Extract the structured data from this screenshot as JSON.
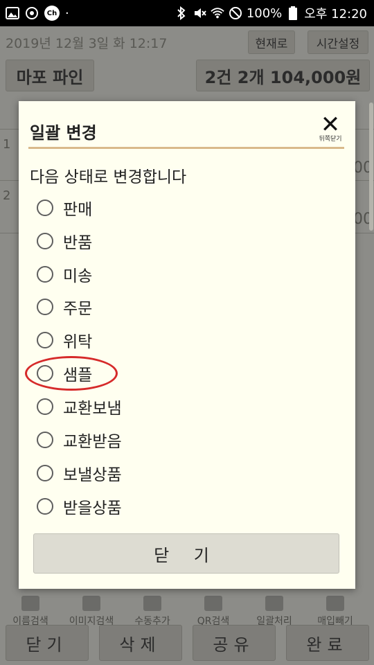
{
  "status_bar": {
    "battery": "100%",
    "time": "오후 12:20",
    "left_icons": [
      "image-icon",
      "target-icon",
      "ch-app-icon",
      "dot-icon"
    ],
    "right_icons": [
      "bluetooth-icon",
      "mute-icon",
      "wifi-icon",
      "dnd-icon",
      "battery-icon"
    ],
    "ch_label": "Ch",
    "dot": "·"
  },
  "app": {
    "date": "2019년 12월 3일 화 12:17",
    "now_button": "현재로",
    "time_setting_button": "시간설정",
    "store_name": "마포 파인",
    "summary": "2건 2개 104,000원",
    "bg_row_numbers": [
      "1",
      "2"
    ],
    "bg_amount_fragments": [
      "00",
      "00"
    ],
    "toolbar": [
      {
        "label": "이름검색",
        "icon": "search-icon"
      },
      {
        "label": "이미지검색",
        "icon": "image-search-icon"
      },
      {
        "label": "수동추가",
        "icon": "add-icon"
      },
      {
        "label": "QR검색",
        "icon": "qr-icon"
      },
      {
        "label": "일괄처리",
        "icon": "batch-icon"
      },
      {
        "label": "매입빼기",
        "icon": "purchase-icon"
      }
    ],
    "bottom_buttons": [
      "닫기",
      "삭제",
      "공유",
      "완료"
    ]
  },
  "dialog": {
    "title": "일괄 변경",
    "close_label": "뒤쪽닫기",
    "subtitle": "다음 상태로 변경합니다",
    "options": [
      "판매",
      "반품",
      "미송",
      "주문",
      "위탁",
      "샘플",
      "교환보냄",
      "교환받음",
      "보낼상품",
      "받을상품"
    ],
    "highlighted_option": "샘플",
    "close_button": "닫 기",
    "highlight_color": "#d62a2a"
  }
}
